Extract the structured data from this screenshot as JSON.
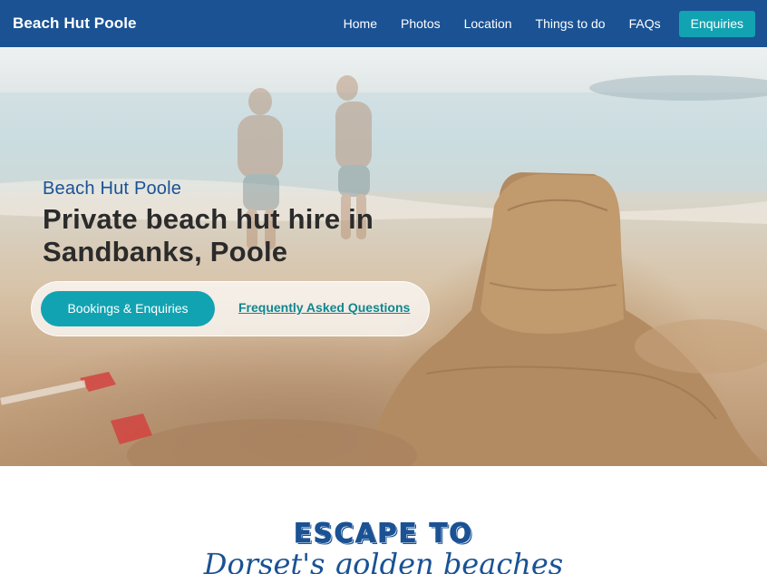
{
  "nav": {
    "brand": "Beach Hut Poole",
    "links": [
      {
        "label": "Home"
      },
      {
        "label": "Photos"
      },
      {
        "label": "Location"
      },
      {
        "label": "Things to do"
      },
      {
        "label": "FAQs"
      }
    ],
    "cta": "Enquiries"
  },
  "hero": {
    "subtitle": "Beach Hut Poole",
    "title": "Private beach hut hire in Sandbanks, Poole",
    "primary_button": "Bookings & Enquiries",
    "secondary_link": "Frequently Asked Questions"
  },
  "section": {
    "heading": "ESCAPE TO",
    "tagline": "Dorset's golden beaches"
  },
  "colors": {
    "nav_bg": "#1a5294",
    "accent": "#12a3b2",
    "link": "#12868f",
    "title_text": "#2b2b2b"
  }
}
